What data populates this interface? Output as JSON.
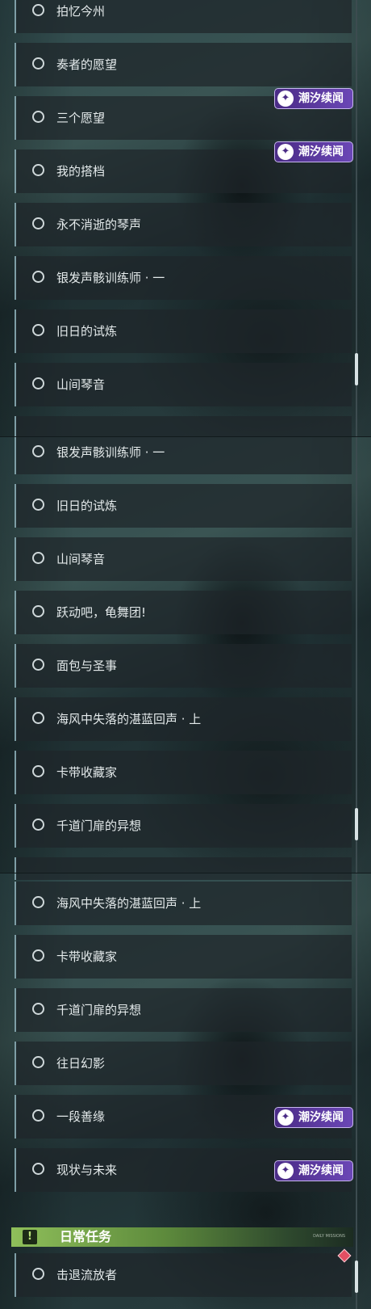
{
  "quest_badge": {
    "label": "潮汐续闻",
    "icon": "wave-feather-icon"
  },
  "daily_header": {
    "title": "日常任务",
    "icon_glyph": "!",
    "small_text": "DAILY MISSIONS"
  },
  "panel1": {
    "quests": [
      "拍忆今州",
      "奏者的愿望",
      "三个愿望",
      "我的搭档",
      "永不消逝的琴声",
      "银发声骸训练师 · 一",
      "旧日的试炼",
      "山间琴音"
    ]
  },
  "panel2": {
    "quests": [
      "银发声骸训练师 · 一",
      "旧日的试炼",
      "山间琴音",
      "跃动吧，龟舞团!",
      "面包与圣事",
      "海风中失落的湛蓝回声 · 上",
      "卡带收藏家",
      "千道门扉的异想"
    ]
  },
  "panel3": {
    "quests": [
      "海风中失落的湛蓝回声 · 上",
      "卡带收藏家",
      "千道门扉的异想",
      "往日幻影",
      "一段善缘",
      "现状与未来"
    ],
    "daily_quests": [
      "击退流放者"
    ]
  },
  "colors": {
    "badge": "#5a3a9e",
    "daily_accent": "#8fbf5a",
    "alert": "#e24f63"
  }
}
